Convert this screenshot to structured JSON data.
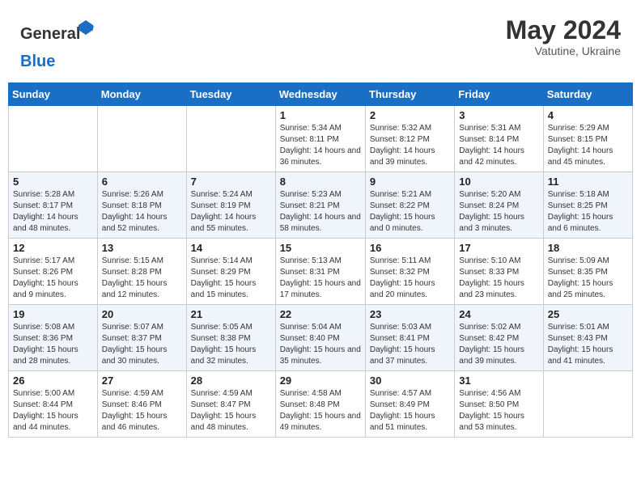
{
  "header": {
    "logo_general": "General",
    "logo_blue": "Blue",
    "month_title": "May 2024",
    "subtitle": "Vatutine, Ukraine"
  },
  "days_of_week": [
    "Sunday",
    "Monday",
    "Tuesday",
    "Wednesday",
    "Thursday",
    "Friday",
    "Saturday"
  ],
  "weeks": [
    [
      {
        "day": "",
        "info": ""
      },
      {
        "day": "",
        "info": ""
      },
      {
        "day": "",
        "info": ""
      },
      {
        "day": "1",
        "info": "Sunrise: 5:34 AM\nSunset: 8:11 PM\nDaylight: 14 hours and 36 minutes."
      },
      {
        "day": "2",
        "info": "Sunrise: 5:32 AM\nSunset: 8:12 PM\nDaylight: 14 hours and 39 minutes."
      },
      {
        "day": "3",
        "info": "Sunrise: 5:31 AM\nSunset: 8:14 PM\nDaylight: 14 hours and 42 minutes."
      },
      {
        "day": "4",
        "info": "Sunrise: 5:29 AM\nSunset: 8:15 PM\nDaylight: 14 hours and 45 minutes."
      }
    ],
    [
      {
        "day": "5",
        "info": "Sunrise: 5:28 AM\nSunset: 8:17 PM\nDaylight: 14 hours and 48 minutes."
      },
      {
        "day": "6",
        "info": "Sunrise: 5:26 AM\nSunset: 8:18 PM\nDaylight: 14 hours and 52 minutes."
      },
      {
        "day": "7",
        "info": "Sunrise: 5:24 AM\nSunset: 8:19 PM\nDaylight: 14 hours and 55 minutes."
      },
      {
        "day": "8",
        "info": "Sunrise: 5:23 AM\nSunset: 8:21 PM\nDaylight: 14 hours and 58 minutes."
      },
      {
        "day": "9",
        "info": "Sunrise: 5:21 AM\nSunset: 8:22 PM\nDaylight: 15 hours and 0 minutes."
      },
      {
        "day": "10",
        "info": "Sunrise: 5:20 AM\nSunset: 8:24 PM\nDaylight: 15 hours and 3 minutes."
      },
      {
        "day": "11",
        "info": "Sunrise: 5:18 AM\nSunset: 8:25 PM\nDaylight: 15 hours and 6 minutes."
      }
    ],
    [
      {
        "day": "12",
        "info": "Sunrise: 5:17 AM\nSunset: 8:26 PM\nDaylight: 15 hours and 9 minutes."
      },
      {
        "day": "13",
        "info": "Sunrise: 5:15 AM\nSunset: 8:28 PM\nDaylight: 15 hours and 12 minutes."
      },
      {
        "day": "14",
        "info": "Sunrise: 5:14 AM\nSunset: 8:29 PM\nDaylight: 15 hours and 15 minutes."
      },
      {
        "day": "15",
        "info": "Sunrise: 5:13 AM\nSunset: 8:31 PM\nDaylight: 15 hours and 17 minutes."
      },
      {
        "day": "16",
        "info": "Sunrise: 5:11 AM\nSunset: 8:32 PM\nDaylight: 15 hours and 20 minutes."
      },
      {
        "day": "17",
        "info": "Sunrise: 5:10 AM\nSunset: 8:33 PM\nDaylight: 15 hours and 23 minutes."
      },
      {
        "day": "18",
        "info": "Sunrise: 5:09 AM\nSunset: 8:35 PM\nDaylight: 15 hours and 25 minutes."
      }
    ],
    [
      {
        "day": "19",
        "info": "Sunrise: 5:08 AM\nSunset: 8:36 PM\nDaylight: 15 hours and 28 minutes."
      },
      {
        "day": "20",
        "info": "Sunrise: 5:07 AM\nSunset: 8:37 PM\nDaylight: 15 hours and 30 minutes."
      },
      {
        "day": "21",
        "info": "Sunrise: 5:05 AM\nSunset: 8:38 PM\nDaylight: 15 hours and 32 minutes."
      },
      {
        "day": "22",
        "info": "Sunrise: 5:04 AM\nSunset: 8:40 PM\nDaylight: 15 hours and 35 minutes."
      },
      {
        "day": "23",
        "info": "Sunrise: 5:03 AM\nSunset: 8:41 PM\nDaylight: 15 hours and 37 minutes."
      },
      {
        "day": "24",
        "info": "Sunrise: 5:02 AM\nSunset: 8:42 PM\nDaylight: 15 hours and 39 minutes."
      },
      {
        "day": "25",
        "info": "Sunrise: 5:01 AM\nSunset: 8:43 PM\nDaylight: 15 hours and 41 minutes."
      }
    ],
    [
      {
        "day": "26",
        "info": "Sunrise: 5:00 AM\nSunset: 8:44 PM\nDaylight: 15 hours and 44 minutes."
      },
      {
        "day": "27",
        "info": "Sunrise: 4:59 AM\nSunset: 8:46 PM\nDaylight: 15 hours and 46 minutes."
      },
      {
        "day": "28",
        "info": "Sunrise: 4:59 AM\nSunset: 8:47 PM\nDaylight: 15 hours and 48 minutes."
      },
      {
        "day": "29",
        "info": "Sunrise: 4:58 AM\nSunset: 8:48 PM\nDaylight: 15 hours and 49 minutes."
      },
      {
        "day": "30",
        "info": "Sunrise: 4:57 AM\nSunset: 8:49 PM\nDaylight: 15 hours and 51 minutes."
      },
      {
        "day": "31",
        "info": "Sunrise: 4:56 AM\nSunset: 8:50 PM\nDaylight: 15 hours and 53 minutes."
      },
      {
        "day": "",
        "info": ""
      }
    ]
  ]
}
